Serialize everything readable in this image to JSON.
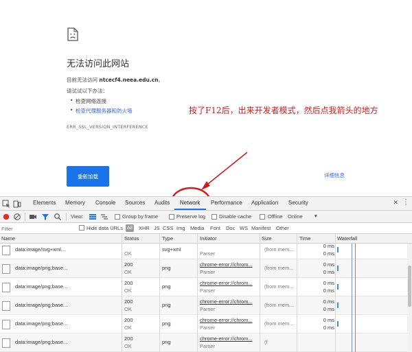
{
  "error_page": {
    "title": "无法访问此网站",
    "line1_prefix": "目前无法访问",
    "line1_host": "ntcecf4.neea.edu.cn",
    "line1_suffix": "。",
    "try_label": "请试试以下办法：",
    "bullets": [
      "检查网络连接",
      "检查代理服务器和防火墙"
    ],
    "error_code": "ERR_SSL_VERSION_INTERFERENCE",
    "reload_button": "重新加载",
    "details_link": "详细信息"
  },
  "annotation": {
    "text": "按了F12后，出来开发者模式，然后点我箭头的地方",
    "color": "#d11b1b"
  },
  "devtools": {
    "tabs": [
      "Elements",
      "Memory",
      "Console",
      "Sources",
      "Audits",
      "Network",
      "Performance",
      "Application",
      "Security"
    ],
    "active_tab": "Network",
    "toolbar": {
      "view_label": "View:",
      "group_by_frame": "Group by frame",
      "preserve_log": "Preserve log",
      "disable_cache": "Disable cache",
      "offline": "Offline",
      "online": "Online"
    },
    "filter": {
      "placeholder": "Filter",
      "hide_data_urls": "Hide data URLs",
      "types": [
        "All",
        "XHR",
        "JS",
        "CSS",
        "Img",
        "Media",
        "Font",
        "Doc",
        "WS",
        "Manifest",
        "Other"
      ]
    },
    "columns": [
      "Name",
      "Status",
      "Type",
      "Initiator",
      "Size",
      "Time",
      "Waterfall"
    ],
    "rows": [
      {
        "name": "data:image/svg+xml...",
        "status": "",
        "status_text": "OK",
        "type": "svg+xml",
        "initiator": "",
        "initiator_sub": "Parser",
        "size": "(from mem...",
        "time": "0 ms",
        "time_sub": "0 ms"
      },
      {
        "name": "data:image/png;base...",
        "status": "200",
        "status_text": "OK",
        "type": "png",
        "initiator": "chrome-error://chrom...",
        "initiator_sub": "Parser",
        "size": "(from mem...",
        "time": "0 ms",
        "time_sub": "0 ms"
      },
      {
        "name": "data:image/png;base...",
        "status": "200",
        "status_text": "OK",
        "type": "png",
        "initiator": "chrome-error://chrom...",
        "initiator_sub": "Parser",
        "size": "(from mem...",
        "time": "0 ms",
        "time_sub": "0 ms"
      },
      {
        "name": "data:image/png;base...",
        "status": "200",
        "status_text": "OK",
        "type": "png",
        "initiator": "chrome-error://chrom...",
        "initiator_sub": "Parser",
        "size": "(from mem...",
        "time": "0 ms",
        "time_sub": "0 ms"
      },
      {
        "name": "data:image/png;base...",
        "status": "200",
        "status_text": "OK",
        "type": "png",
        "initiator": "chrome-error://chrom...",
        "initiator_sub": "Parser",
        "size": "(from mem...",
        "time": "0 ms",
        "time_sub": "0 ms"
      },
      {
        "name": "data:image/png;base...",
        "status": "200",
        "status_text": "OK",
        "type": "png",
        "initiator": "chrome-error://chrom...",
        "initiator_sub": "Parser",
        "size": "(f",
        "time": "",
        "time_sub": ""
      }
    ]
  }
}
